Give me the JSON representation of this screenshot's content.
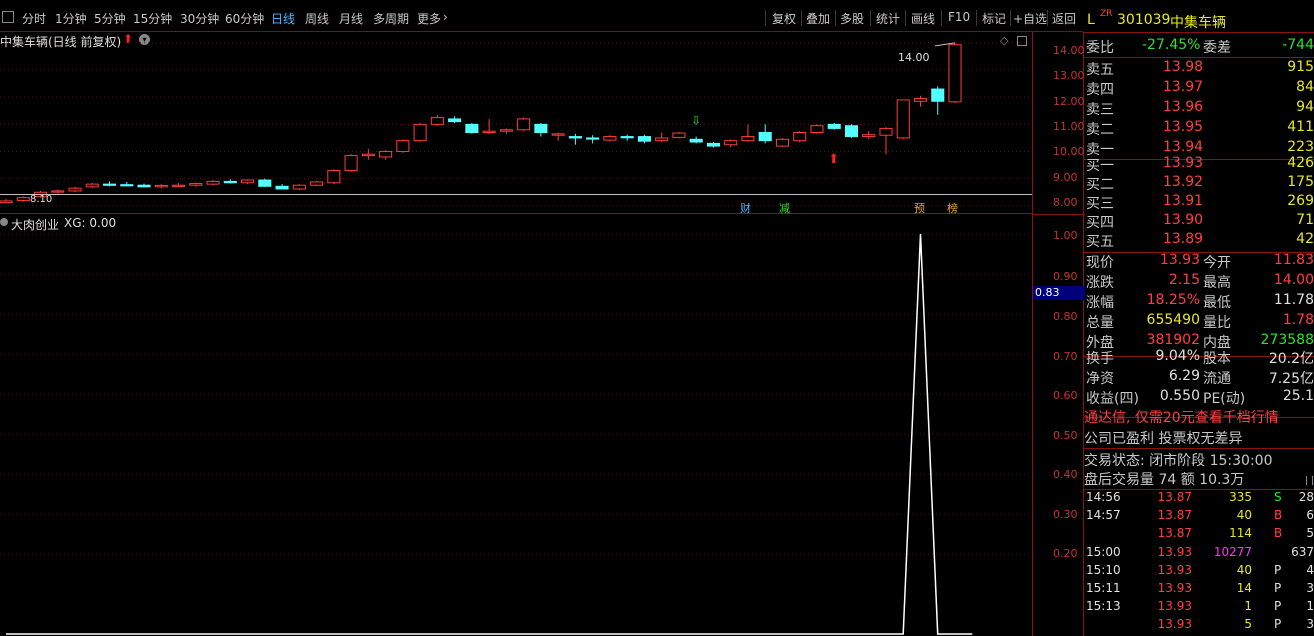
{
  "toolbar": {
    "periods": [
      "分时",
      "1分钟",
      "5分钟",
      "15分钟",
      "30分钟",
      "60分钟",
      "日线",
      "周线",
      "月线",
      "多周期",
      "更多"
    ],
    "active_period": "日线",
    "right_buttons": [
      "复权",
      "叠加",
      "多股",
      "统计",
      "画线",
      "F10",
      "标记",
      "+自选",
      "返回"
    ]
  },
  "main_chart": {
    "title": "中集车辆(日线 前复权)",
    "high_label": "14.00",
    "low_label": "8.10",
    "y_ticks": [
      "14.00",
      "13.00",
      "12.00",
      "11.00",
      "10.00",
      "9.00",
      "8.00"
    ],
    "markers": [
      "财",
      "减",
      "预",
      "榜"
    ],
    "colors": {
      "up": "#ff3c3c",
      "down": "#54ffff",
      "axis": "#c83232",
      "border": "#8a1010"
    }
  },
  "indicator_chart": {
    "title": "大肉创业",
    "xg_label": "XG: 0.00",
    "y_ticks": [
      "1.00",
      "0.90",
      "0.80",
      "0.70",
      "0.60",
      "0.50",
      "0.40",
      "0.30",
      "0.20"
    ],
    "cursor_value": "0.83",
    "series": [
      0,
      0,
      0,
      0,
      0,
      0,
      0,
      0,
      0,
      0,
      0,
      0,
      0,
      0,
      0,
      0,
      0,
      0,
      0,
      0,
      0,
      0,
      0,
      0,
      0,
      0,
      0,
      0,
      0,
      0,
      0,
      0,
      0,
      0,
      0,
      0,
      0,
      0,
      0,
      0,
      0,
      0,
      0,
      0,
      0,
      0,
      0,
      0,
      0,
      0,
      0,
      0,
      0,
      1,
      0,
      0,
      0
    ]
  },
  "chart_data": {
    "type": "candlestick",
    "y_range": [
      7.7,
      14.4
    ],
    "candles": [
      {
        "o": 8.12,
        "h": 8.25,
        "l": 8.1,
        "c": 8.18
      },
      {
        "o": 8.2,
        "h": 8.35,
        "l": 8.15,
        "c": 8.3
      },
      {
        "o": 8.35,
        "h": 8.55,
        "l": 8.3,
        "c": 8.5
      },
      {
        "o": 8.52,
        "h": 8.6,
        "l": 8.45,
        "c": 8.55
      },
      {
        "o": 8.55,
        "h": 8.7,
        "l": 8.5,
        "c": 8.65
      },
      {
        "o": 8.7,
        "h": 8.85,
        "l": 8.65,
        "c": 8.8
      },
      {
        "o": 8.8,
        "h": 8.9,
        "l": 8.72,
        "c": 8.76
      },
      {
        "o": 8.78,
        "h": 8.88,
        "l": 8.72,
        "c": 8.75
      },
      {
        "o": 8.76,
        "h": 8.82,
        "l": 8.68,
        "c": 8.7
      },
      {
        "o": 8.7,
        "h": 8.8,
        "l": 8.64,
        "c": 8.75
      },
      {
        "o": 8.74,
        "h": 8.84,
        "l": 8.7,
        "c": 8.76
      },
      {
        "o": 8.76,
        "h": 8.86,
        "l": 8.7,
        "c": 8.82
      },
      {
        "o": 8.8,
        "h": 8.95,
        "l": 8.76,
        "c": 8.9
      },
      {
        "o": 8.9,
        "h": 8.98,
        "l": 8.82,
        "c": 8.85
      },
      {
        "o": 8.85,
        "h": 8.98,
        "l": 8.8,
        "c": 8.95
      },
      {
        "o": 8.95,
        "h": 9.0,
        "l": 8.7,
        "c": 8.72
      },
      {
        "o": 8.72,
        "h": 8.8,
        "l": 8.6,
        "c": 8.62
      },
      {
        "o": 8.62,
        "h": 8.8,
        "l": 8.58,
        "c": 8.76
      },
      {
        "o": 8.76,
        "h": 8.92,
        "l": 8.72,
        "c": 8.88
      },
      {
        "o": 8.85,
        "h": 9.35,
        "l": 8.8,
        "c": 9.3
      },
      {
        "o": 9.3,
        "h": 9.9,
        "l": 9.25,
        "c": 9.85
      },
      {
        "o": 9.85,
        "h": 10.1,
        "l": 9.7,
        "c": 9.9
      },
      {
        "o": 9.8,
        "h": 10.05,
        "l": 9.7,
        "c": 10.0
      },
      {
        "o": 10.0,
        "h": 10.45,
        "l": 9.95,
        "c": 10.4
      },
      {
        "o": 10.4,
        "h": 11.05,
        "l": 10.35,
        "c": 11.0
      },
      {
        "o": 11.0,
        "h": 11.35,
        "l": 10.95,
        "c": 11.25
      },
      {
        "o": 11.2,
        "h": 11.3,
        "l": 11.05,
        "c": 11.1
      },
      {
        "o": 11.0,
        "h": 11.05,
        "l": 10.65,
        "c": 10.7
      },
      {
        "o": 10.7,
        "h": 11.2,
        "l": 10.65,
        "c": 10.75
      },
      {
        "o": 10.75,
        "h": 10.85,
        "l": 10.65,
        "c": 10.8
      },
      {
        "o": 10.8,
        "h": 11.25,
        "l": 10.75,
        "c": 11.2
      },
      {
        "o": 11.0,
        "h": 11.05,
        "l": 10.55,
        "c": 10.7
      },
      {
        "o": 10.6,
        "h": 10.7,
        "l": 10.4,
        "c": 10.65
      },
      {
        "o": 10.55,
        "h": 10.65,
        "l": 10.25,
        "c": 10.5
      },
      {
        "o": 10.5,
        "h": 10.6,
        "l": 10.3,
        "c": 10.48
      },
      {
        "o": 10.42,
        "h": 10.6,
        "l": 10.38,
        "c": 10.55
      },
      {
        "o": 10.55,
        "h": 10.62,
        "l": 10.4,
        "c": 10.52
      },
      {
        "o": 10.55,
        "h": 10.62,
        "l": 10.3,
        "c": 10.38
      },
      {
        "o": 10.4,
        "h": 10.7,
        "l": 10.35,
        "c": 10.5
      },
      {
        "o": 10.52,
        "h": 10.72,
        "l": 10.48,
        "c": 10.68
      },
      {
        "o": 10.45,
        "h": 10.55,
        "l": 10.3,
        "c": 10.35
      },
      {
        "o": 10.3,
        "h": 10.35,
        "l": 10.15,
        "c": 10.2
      },
      {
        "o": 10.25,
        "h": 10.45,
        "l": 10.15,
        "c": 10.4
      },
      {
        "o": 10.4,
        "h": 11.0,
        "l": 10.35,
        "c": 10.55
      },
      {
        "o": 10.7,
        "h": 11.0,
        "l": 10.3,
        "c": 10.4
      },
      {
        "o": 10.2,
        "h": 10.5,
        "l": 10.15,
        "c": 10.45
      },
      {
        "o": 10.4,
        "h": 10.75,
        "l": 10.35,
        "c": 10.7
      },
      {
        "o": 10.7,
        "h": 11.0,
        "l": 10.65,
        "c": 10.95
      },
      {
        "o": 11.0,
        "h": 11.05,
        "l": 10.8,
        "c": 10.85
      },
      {
        "o": 10.95,
        "h": 11.0,
        "l": 10.5,
        "c": 10.55
      },
      {
        "o": 10.55,
        "h": 10.75,
        "l": 10.45,
        "c": 10.62
      },
      {
        "o": 10.6,
        "h": 10.9,
        "l": 9.9,
        "c": 10.85
      },
      {
        "o": 10.5,
        "h": 11.9,
        "l": 10.45,
        "c": 11.9
      },
      {
        "o": 11.85,
        "h": 12.05,
        "l": 11.65,
        "c": 11.95
      },
      {
        "o": 12.3,
        "h": 12.4,
        "l": 11.35,
        "c": 11.85
      },
      {
        "o": 11.83,
        "h": 14.0,
        "l": 11.78,
        "c": 13.93
      }
    ]
  },
  "quote": {
    "prefix": "L",
    "badge": "ZR",
    "code": "301039",
    "name": "中集车辆",
    "weibi_label": "委比",
    "weibi": "-27.45%",
    "weicha_label": "委差",
    "weicha": "-744",
    "asks": [
      {
        "label": "卖五",
        "price": "13.98",
        "vol": "915"
      },
      {
        "label": "卖四",
        "price": "13.97",
        "vol": "84"
      },
      {
        "label": "卖三",
        "price": "13.96",
        "vol": "94"
      },
      {
        "label": "卖二",
        "price": "13.95",
        "vol": "411"
      },
      {
        "label": "卖一",
        "price": "13.94",
        "vol": "223"
      }
    ],
    "bids": [
      {
        "label": "买一",
        "price": "13.93",
        "vol": "426"
      },
      {
        "label": "买二",
        "price": "13.92",
        "vol": "175"
      },
      {
        "label": "买三",
        "price": "13.91",
        "vol": "269"
      },
      {
        "label": "买四",
        "price": "13.90",
        "vol": "71"
      },
      {
        "label": "买五",
        "price": "13.89",
        "vol": "42"
      }
    ],
    "stats": [
      {
        "l1": "现价",
        "v1": "13.93",
        "c1": "c-red",
        "l2": "今开",
        "v2": "11.83",
        "c2": "c-red"
      },
      {
        "l1": "涨跌",
        "v1": "2.15",
        "c1": "c-red",
        "l2": "最高",
        "v2": "14.00",
        "c2": "c-red"
      },
      {
        "l1": "涨幅",
        "v1": "18.25%",
        "c1": "c-red",
        "l2": "最低",
        "v2": "11.78",
        "c2": "c-white"
      },
      {
        "l1": "总量",
        "v1": "655490",
        "c1": "c-yellow",
        "l2": "量比",
        "v2": "1.78",
        "c2": "c-red"
      },
      {
        "l1": "外盘",
        "v1": "381902",
        "c1": "c-red",
        "l2": "内盘",
        "v2": "273588",
        "c2": "c-green"
      }
    ],
    "stats2": [
      {
        "l1": "换手",
        "v1": "9.04%",
        "l2": "股本",
        "v2": "20.2亿"
      },
      {
        "l1": "净资",
        "v1": "6.29",
        "l2": "流通",
        "v2": "7.25亿"
      },
      {
        "l1": "收益(四)",
        "v1": "0.550",
        "l2": "PE(动)",
        "v2": "25.1"
      }
    ],
    "promo": "通达信, 仅需20元查看千档行情",
    "notice": "公司已盈利 投票权无差异",
    "trade_status": "交易状态: 闭市阶段 15:30:00",
    "after_hours": "盘后交易量 74 额 10.3万"
  },
  "ticks": [
    {
      "time": "14:56",
      "price": "13.87",
      "vol": "335",
      "vc": "c-yellow",
      "side": "S",
      "sc": "c-green",
      "n": "28"
    },
    {
      "time": "14:57",
      "price": "13.87",
      "vol": "40",
      "vc": "c-yellow",
      "side": "B",
      "sc": "c-red",
      "n": "6"
    },
    {
      "time": "",
      "price": "13.87",
      "vol": "114",
      "vc": "c-yellow",
      "side": "B",
      "sc": "c-red",
      "n": "5"
    },
    {
      "time": "15:00",
      "price": "13.93",
      "vol": "10277",
      "vc": "c-mag",
      "side": "",
      "sc": "c-white",
      "n": "637"
    },
    {
      "time": "15:10",
      "price": "13.93",
      "vol": "40",
      "vc": "c-yellow",
      "side": "P",
      "sc": "c-white",
      "n": "4"
    },
    {
      "time": "15:11",
      "price": "13.93",
      "vol": "14",
      "vc": "c-yellow",
      "side": "P",
      "sc": "c-white",
      "n": "3"
    },
    {
      "time": "15:13",
      "price": "13.93",
      "vol": "1",
      "vc": "c-yellow",
      "side": "P",
      "sc": "c-white",
      "n": "1"
    },
    {
      "time": "",
      "price": "13.93",
      "vol": "5",
      "vc": "c-yellow",
      "side": "P",
      "sc": "c-white",
      "n": "3"
    }
  ]
}
